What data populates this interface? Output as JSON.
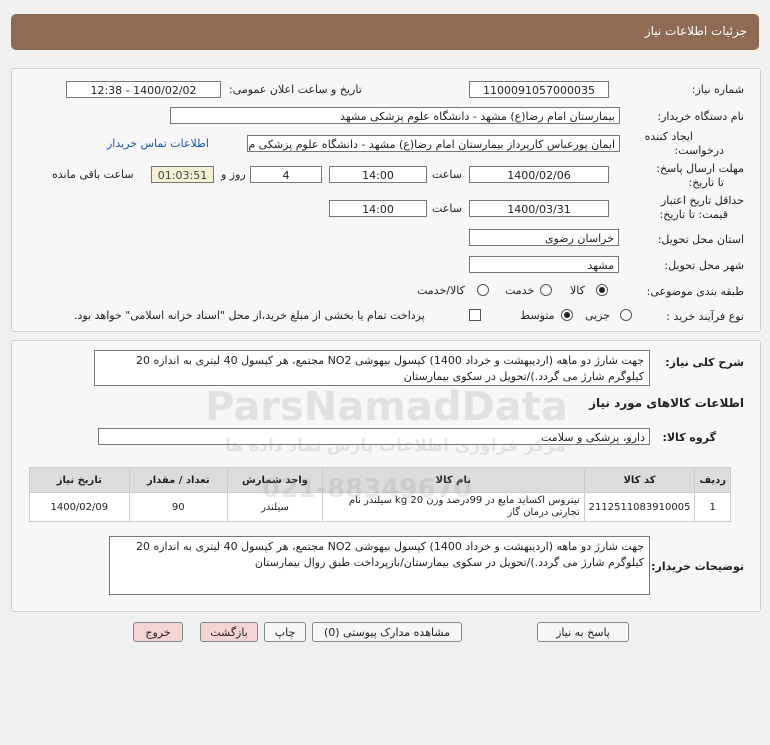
{
  "header": {
    "title": "جزئیات اطلاعات نیاز"
  },
  "fields": {
    "need_number_label": "شماره نیاز:",
    "need_number": "1100091057000035",
    "announce_label": "تاریخ و ساعت اعلان عمومی:",
    "announce_value": "1400/02/02 - 12:38",
    "buyer_org_label": "نام دستگاه خریدار:",
    "buyer_org": "بیمارستان امام رضا(ع) مشهد - دانشگاه علوم پزشکی مشهد",
    "creator_label_1": "ایجاد کننده",
    "creator_label_2": "درخواست:",
    "creator": "ایمان پورعباس کارپرداز بیمارستان امام رضا(ع) مشهد - دانشگاه علوم پزشکی م",
    "contact_link": "اطلاعات تماس خریدار",
    "reply_deadline_label_1": "مهلت ارسال پاسخ:",
    "reply_deadline_label_2": "تا تاریخ:",
    "reply_date": "1400/02/06",
    "time_label": "ساعت",
    "reply_time": "14:00",
    "days_value": "4",
    "days_label": "روز و",
    "remaining_time": "01:03:51",
    "remaining_label": "ساعت باقی مانده",
    "price_deadline_label_1": "حداقل تاریخ اعتبار",
    "price_deadline_label_2": "قیمت: تا تاریخ:",
    "price_date": "1400/03/31",
    "price_time": "14:00",
    "province_label": "استان محل تحویل:",
    "province": "خراسان رضوی",
    "city_label": "شهر محل تحویل:",
    "city": "مشهد",
    "category_label": "طبقه بندی موضوعی:",
    "category_options": [
      "کالا",
      "خدمت",
      "کالا/خدمت"
    ],
    "process_label": "نوع فرآیند خرید :",
    "process_options": [
      "جزیی",
      "متوسط"
    ],
    "payment_note": "پرداخت تمام یا بخشی از مبلغ خرید،از محل \"اسناد خزانه اسلامی\" خواهد بود."
  },
  "summary": {
    "label": "شرح کلی نیاز:",
    "text": "جهت شارژ دو ماهه (اردیبهشت و خرداد 1400) کپسول بیهوشی NO2 مجتمع، هر کپسول 40 لیتری به اندازه 20 کیلوگرم شارژ می گردد.)/تحویل در سکوی بیمارستان"
  },
  "goods": {
    "section_title": "اطلاعات کالاهای مورد نیاز",
    "group_label": "گروه کالا:",
    "group_value": "دارو، پزشکی و سلامت",
    "columns": [
      "ردیف",
      "کد کالا",
      "نام کالا",
      "واحد شمارش",
      "تعداد / مقدار",
      "تاریخ نیاز"
    ],
    "rows": [
      [
        "1",
        "2112511083910005",
        "نیتروس اکساید مایع در 99درصد وزن 20 kg سیلندر نام تجارتی درمان گاز",
        "سیلندر",
        "90",
        "1400/02/09"
      ]
    ]
  },
  "buyer_notes": {
    "label": "توضیحات خریدار:",
    "text": "جهت شارژ دو ماهه (اردیبهشت و خرداد 1400) کپسول بیهوشی NO2 مجتمع، هر کپسول 40 لیتری به اندازه 20 کیلوگرم شارژ می گردد.)/تحویل در سکوی بیمارستان/بازپرداخت طبق روال بیمارستان"
  },
  "buttons": {
    "reply": "پاسخ به نیاز",
    "attachments": "مشاهده مدارک پیوستی (0)",
    "print": "چاپ",
    "back": "بازگشت",
    "exit": "خروج"
  },
  "watermark": {
    "main": "ParsNamadData",
    "sub": "مرکز فراوری اطلاعات پارس نماد داده ها",
    "phone": "021-88349670"
  }
}
